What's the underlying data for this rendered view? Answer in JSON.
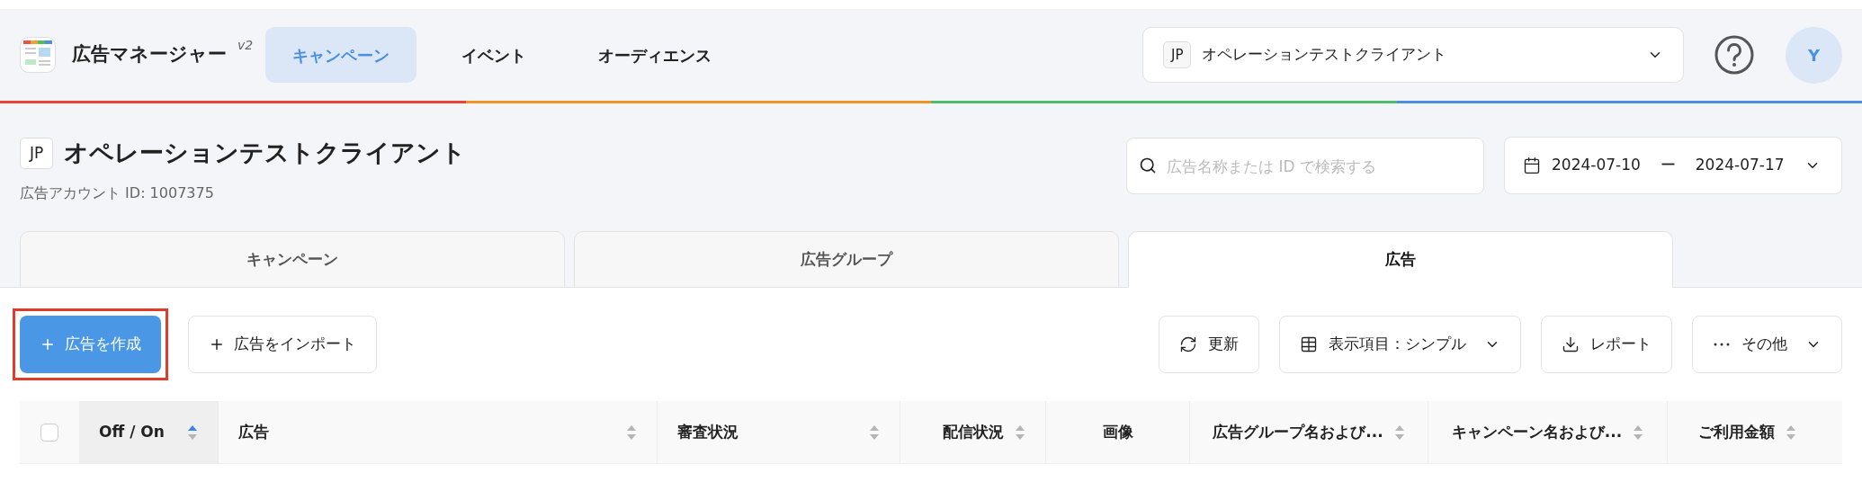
{
  "header": {
    "app_title": "広告マネージャー",
    "version": "v2",
    "nav": [
      {
        "label": "キャンペーン",
        "selected": true
      },
      {
        "label": "イベント",
        "selected": false
      },
      {
        "label": "オーディエンス",
        "selected": false
      }
    ],
    "client_select": {
      "badge": "JP",
      "value": "オペレーションテストクライアント"
    },
    "avatar": "Y"
  },
  "account": {
    "badge": "JP",
    "name": "オペレーションテストクライアント",
    "id_label": "広告アカウント ID: 1007375"
  },
  "search": {
    "placeholder": "広告名称または ID で検索する"
  },
  "date_range": {
    "start": "2024-07-10",
    "separator": "ー",
    "end": "2024-07-17"
  },
  "tabs": [
    {
      "label": "キャンペーン",
      "selected": false
    },
    {
      "label": "広告グループ",
      "selected": false
    },
    {
      "label": "広告",
      "selected": true
    }
  ],
  "actions_left": [
    {
      "label": "広告を作成",
      "kind": "primary",
      "highlighted": true
    },
    {
      "label": "広告をインポート",
      "kind": "secondary",
      "highlighted": false
    }
  ],
  "actions_right": [
    {
      "label": "更新",
      "kind": "refresh"
    },
    {
      "label": "表示項目：シンプル",
      "kind": "columns"
    },
    {
      "label": "レポート",
      "kind": "download"
    },
    {
      "label": "その他",
      "kind": "more"
    }
  ],
  "table": {
    "select_all": {
      "checked": false
    },
    "columns": [
      {
        "label": "Off / On",
        "sortable": true,
        "sorted": true
      },
      {
        "label": "広告",
        "sortable": true,
        "sorted": false
      },
      {
        "label": "審査状況",
        "sortable": true,
        "sorted": false
      },
      {
        "label": "配信状況",
        "sortable": true,
        "sorted": false
      },
      {
        "label": "画像",
        "sortable": false,
        "sorted": false
      },
      {
        "label": "広告グループ名および...",
        "sortable": true,
        "sorted": false
      },
      {
        "label": "キャンペーン名および...",
        "sortable": true,
        "sorted": false
      },
      {
        "label": "ご利用金額",
        "sortable": true,
        "sorted": false
      }
    ]
  }
}
